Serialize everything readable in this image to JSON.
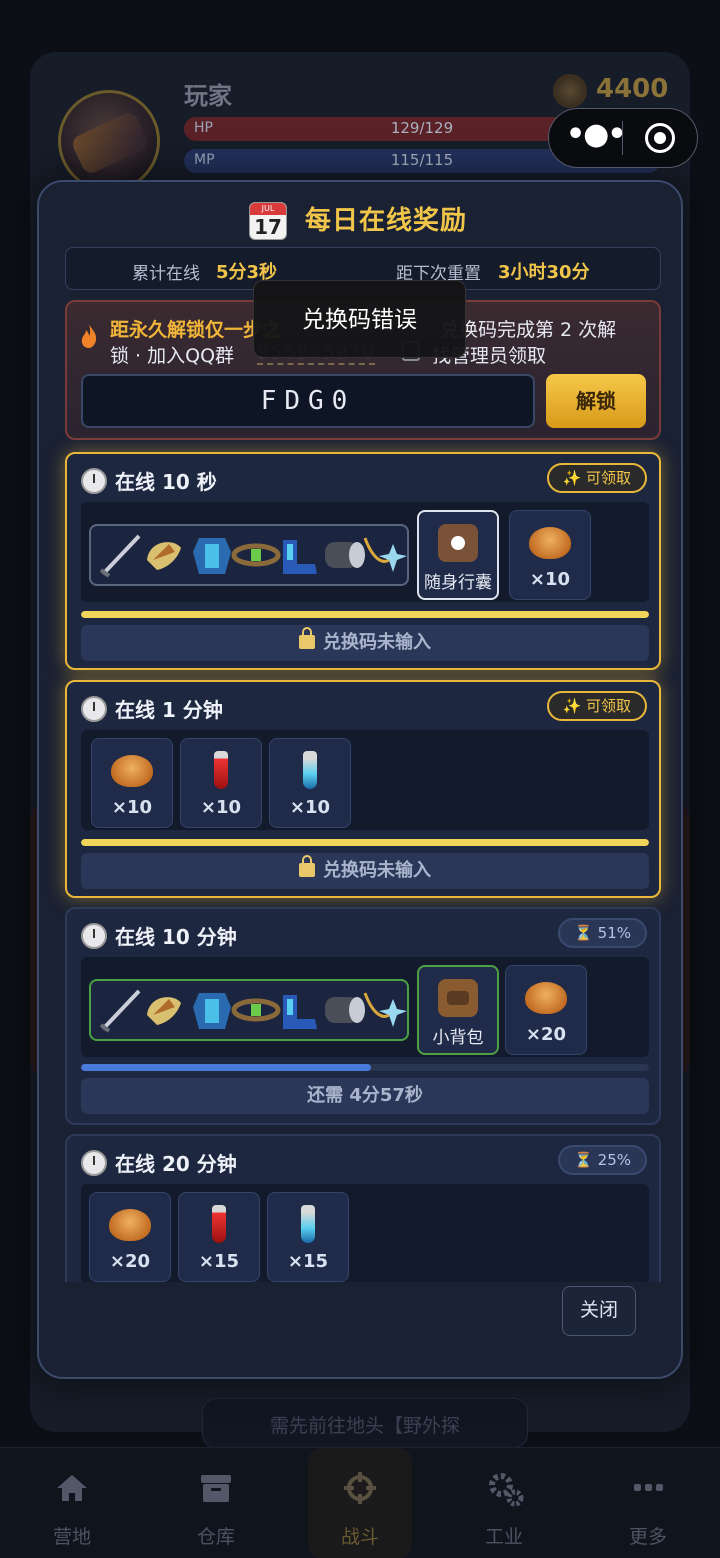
{
  "player": {
    "name": "玩家",
    "gold": "4400",
    "hp_label": "HP",
    "hp": "129/129",
    "mp_label": "MP",
    "mp": "115/115"
  },
  "miniprogram_capsule": {
    "menu_icon": "more-dots-icon",
    "close_icon": "target-close-icon"
  },
  "modal": {
    "title": "每日在线奖励",
    "calendar_icon": {
      "month": "JUL",
      "day": "17"
    },
    "online_label": "累计在线",
    "online_value": "5分3秒",
    "reset_label": "距下次重置",
    "reset_value": "3小时30分",
    "unlock": {
      "headline": "距永久解锁仅一步之",
      "text_right": "兑换码完成第 2 次解",
      "text_line2": "锁 · 加入QQ群",
      "qq_group": "956925970",
      "text_line2_end": "找管理员领取",
      "code_value": "FDG0",
      "unlock_button": "解锁"
    },
    "toast": "兑换码错误",
    "close_button": "关闭",
    "tiers": [
      {
        "title": "在线 10 秒",
        "badge": "可领取",
        "bag_label": "随身行囊",
        "bread_qty": "×10",
        "progress": 1.0,
        "footer": "兑换码未输入"
      },
      {
        "title": "在线 1 分钟",
        "badge": "可领取",
        "items": [
          "×10",
          "×10",
          "×10"
        ],
        "progress": 1.0,
        "footer": "兑换码未输入"
      },
      {
        "title": "在线 10 分钟",
        "badge": "51%",
        "bag_label": "小背包",
        "bread_qty": "×20",
        "progress": 0.51,
        "footer": "还需 4分57秒"
      },
      {
        "title": "在线 20 分钟",
        "badge": "25%",
        "items": [
          "×20",
          "×15",
          "×15"
        ],
        "progress": 0.25
      }
    ]
  },
  "background_button": "需先前往地头【野外探",
  "nav": [
    {
      "label": "营地",
      "icon": "home-icon"
    },
    {
      "label": "仓库",
      "icon": "storage-box-icon"
    },
    {
      "label": "战斗",
      "icon": "crosshair-icon"
    },
    {
      "label": "工业",
      "icon": "gears-icon"
    },
    {
      "label": "更多",
      "icon": "more-dots-icon"
    }
  ],
  "colors": {
    "accent_gold": "#f1c54a",
    "hp_red": "#7a2a2e",
    "mp_blue": "#2a3c6e",
    "progress_blue": "#4a7ad8"
  }
}
